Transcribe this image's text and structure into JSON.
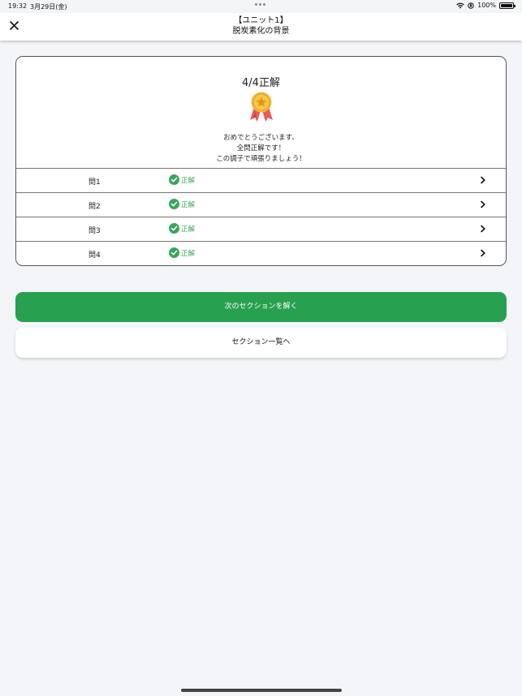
{
  "status_bar": {
    "time": "19:32",
    "date": "3月29日(金)",
    "battery_text": "100%",
    "battery_level": 1.0
  },
  "nav": {
    "title_line1": "【ユニット1】",
    "title_line2": "脱炭素化の背景",
    "close_icon": "close-icon"
  },
  "result": {
    "score": "4/4正解",
    "medal_icon": "medal-icon",
    "message_lines": [
      "おめでとうございます、",
      "全問正解です！",
      "この調子で頑張りましょう！"
    ]
  },
  "questions": [
    {
      "label": "問1",
      "status": "正解"
    },
    {
      "label": "問2",
      "status": "正解"
    },
    {
      "label": "問3",
      "status": "正解"
    },
    {
      "label": "問4",
      "status": "正解"
    }
  ],
  "buttons": {
    "next_section": "次のセクションを解く",
    "section_list": "セクション一覧へ"
  },
  "colors": {
    "accent_green": "#27a050",
    "correct_green": "#3aa55a",
    "background": "#f4f5f9"
  }
}
